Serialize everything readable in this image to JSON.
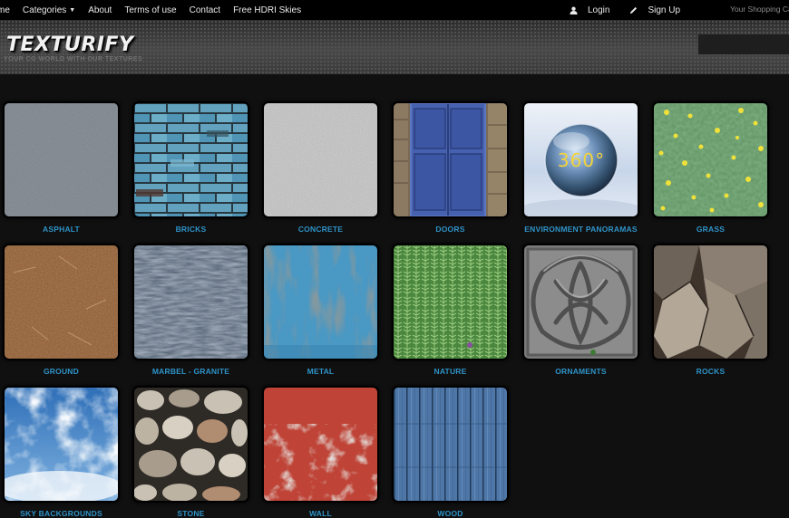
{
  "nav": {
    "links": [
      "me",
      "Categories",
      "About",
      "Terms of use",
      "Contact",
      "Free HDRI Skies"
    ],
    "login": "Login",
    "signup": "Sign Up",
    "cart": "Your Shopping Ca"
  },
  "header": {
    "logo": "TEXTURIFY",
    "tagline": "YOUR CG WORLD WITH OUR TEXTURES"
  },
  "categories": [
    {
      "label": "ASPHALT"
    },
    {
      "label": "BRICKS"
    },
    {
      "label": "CONCRETE"
    },
    {
      "label": "DOORS"
    },
    {
      "label": "ENVIRONMENT PANORAMAS",
      "badge": "360°"
    },
    {
      "label": "GRASS"
    },
    {
      "label": "GROUND"
    },
    {
      "label": "MARBEL - GRANITE"
    },
    {
      "label": "METAL"
    },
    {
      "label": "NATURE"
    },
    {
      "label": "ORNAMENTS"
    },
    {
      "label": "ROCKS"
    },
    {
      "label": "SKY BACKGROUNDS"
    },
    {
      "label": "STONE"
    },
    {
      "label": "WALL"
    },
    {
      "label": "WOOD"
    }
  ],
  "colors": {
    "background": "#101010",
    "label": "#2f93c8",
    "nav": "#000000"
  }
}
